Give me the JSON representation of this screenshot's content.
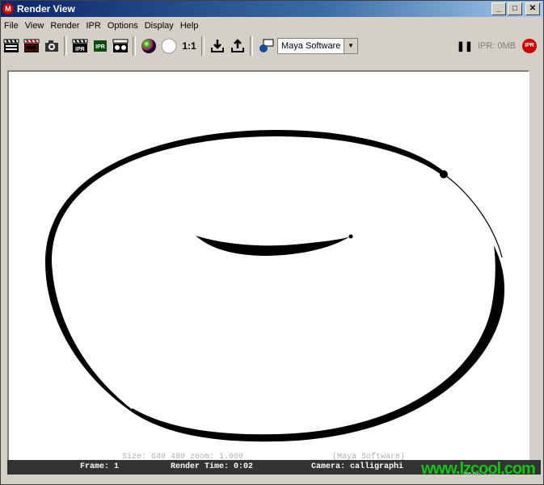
{
  "window": {
    "title": "Render View"
  },
  "menubar": {
    "items": [
      "File",
      "View",
      "Render",
      "IPR",
      "Options",
      "Display",
      "Help"
    ]
  },
  "toolbar": {
    "ipr_label_1": "IPR",
    "ipr_label_2": "IPR",
    "ratio_label": "1:1",
    "renderer_value": "Maya Software",
    "ipr_memory": "IPR: 0MB",
    "ipr_badge": "IPR"
  },
  "render": {
    "size_overlay": "Size:  640  480 zoom: 1.000",
    "renderer_overlay": "(Maya Software)"
  },
  "status": {
    "frame": "Frame: 1",
    "render_time": "Render Time: 0:02",
    "camera": "Camera: calligraphi"
  },
  "watermark": {
    "text": "www.lzcool.com",
    "sub": "2009.com.cn"
  },
  "colors": {
    "title_start": "#0a246a",
    "title_end": "#a6caf0",
    "stroke": "#000000"
  }
}
